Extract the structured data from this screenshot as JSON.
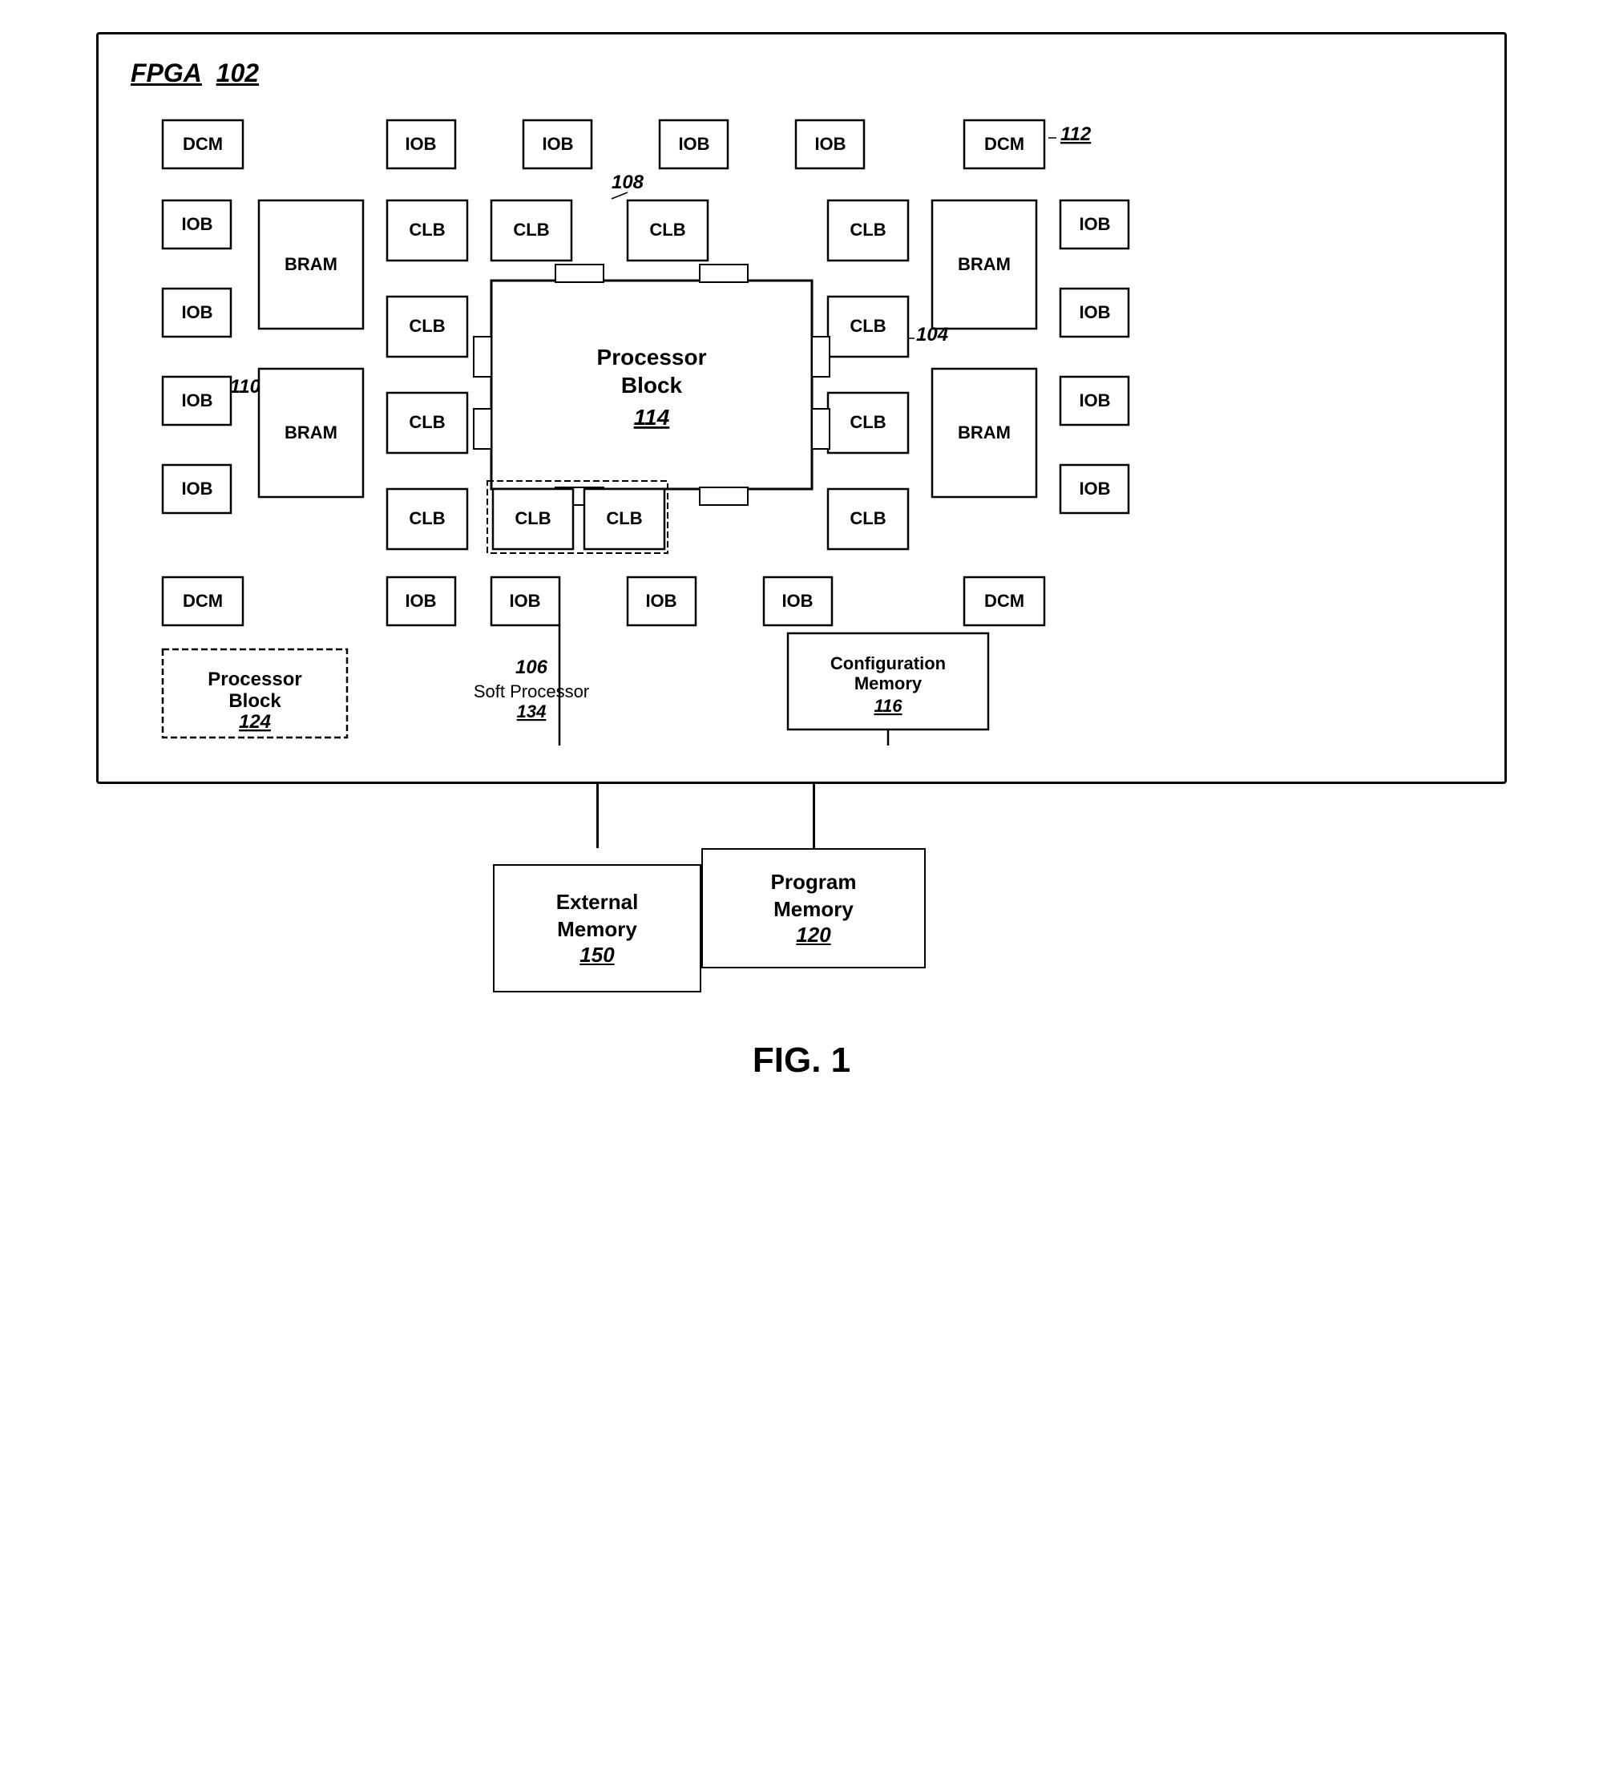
{
  "title": "FIG. 1",
  "fpga": {
    "label": "FPGA",
    "ref": "102"
  },
  "components": {
    "dcm": "DCM",
    "iob": "IOB",
    "clb": "CLB",
    "bram": "BRAM"
  },
  "processor_block_114": {
    "label": "Processor\nBlock",
    "ref": "114"
  },
  "processor_block_124": {
    "label": "Processor\nBlock",
    "ref": "124"
  },
  "soft_processor": {
    "label": "Soft Processor",
    "ref": "134"
  },
  "soft_processor_ref_label": "106",
  "configuration_memory": {
    "label": "Configuration\nMemory",
    "ref": "116"
  },
  "program_memory": {
    "label": "Program\nMemory",
    "ref": "120"
  },
  "external_memory": {
    "label": "External\nMemory",
    "ref": "150"
  },
  "ref_104": "104",
  "ref_108": "108",
  "ref_110": "110",
  "ref_112": "112"
}
